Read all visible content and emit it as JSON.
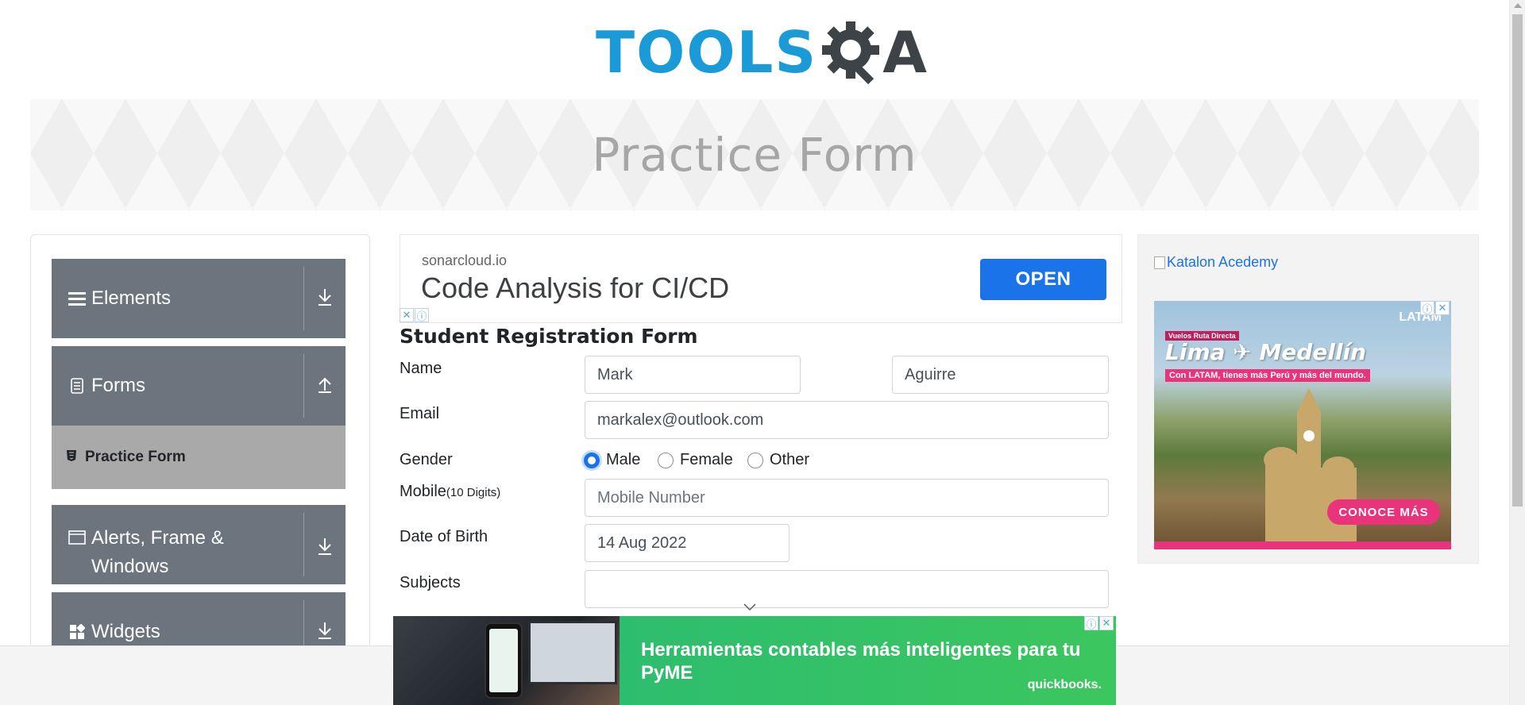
{
  "header": {
    "logo_text_left": "TOOLS",
    "logo_text_right": "A"
  },
  "banner": {
    "title": "Practice Form"
  },
  "sidebar": {
    "groups": [
      {
        "label": "Elements",
        "icon": "menu-icon",
        "expanded": false
      },
      {
        "label": "Forms",
        "icon": "document-icon",
        "expanded": true
      },
      {
        "label": "Alerts, Frame &",
        "label_line2": "Windows",
        "icon": "window-icon",
        "expanded": false
      },
      {
        "label": "Widgets",
        "icon": "widgets-icon",
        "expanded": false
      }
    ],
    "active_item": {
      "label": "Practice Form",
      "icon": "html5-icon"
    }
  },
  "ad_top": {
    "domain": "sonarcloud.io",
    "headline": "Code Analysis for CI/CD",
    "cta": "OPEN"
  },
  "form": {
    "title": "Student Registration Form",
    "name_label": "Name",
    "first_name": "Mark",
    "last_name": "Aguirre",
    "email_label": "Email",
    "email": "markalex@outlook.com",
    "gender_label": "Gender",
    "genders": [
      "Male",
      "Female",
      "Other"
    ],
    "gender_selected": "Male",
    "mobile_label": "Mobile",
    "mobile_hint": "(10 Digits)",
    "mobile_placeholder": "Mobile Number",
    "dob_label": "Date of Birth",
    "dob": "14 Aug 2022",
    "subjects_label": "Subjects",
    "subjects": ""
  },
  "ad_right": {
    "image_alt": "Katalon Acedemy",
    "latam_brand": "LATAM",
    "ruta": "Vuelos Ruta Directa",
    "destination": "Lima ✈ Medellín",
    "tagline": "Con LATAM, tienes más Perú y más del mundo.",
    "cta": "CONOCE MÁS"
  },
  "ad_bottom": {
    "headline_line1": "Herramientas contables más inteligentes para tu",
    "headline_line2": "PyME",
    "brand": "quickbooks."
  },
  "colors": {
    "sidebar_group": "#6c757d",
    "sidebar_active": "#a9a9a9",
    "accent": "#1a73e8",
    "logo_blue": "#1a9ad6"
  }
}
